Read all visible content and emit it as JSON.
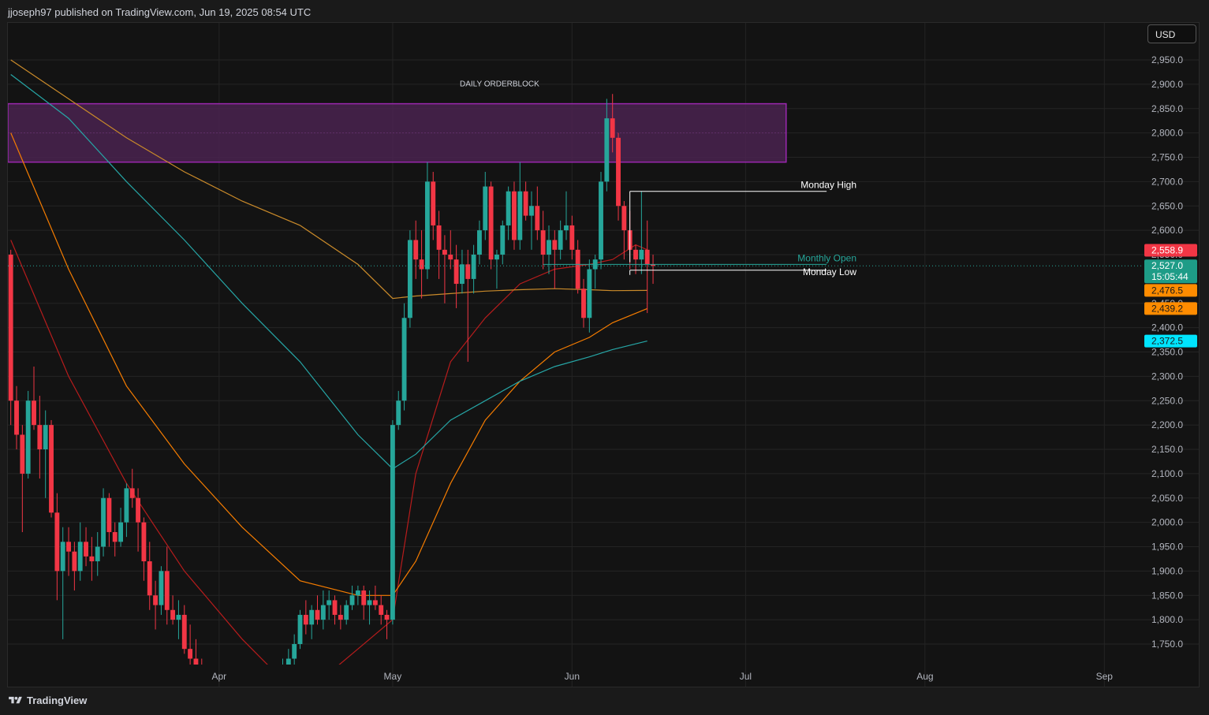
{
  "header": {
    "published_text": "jjoseph97 published on TradingView.com, Jun 19, 2025 08:54 UTC"
  },
  "currency_button": {
    "label": "USD"
  },
  "footer": {
    "brand": "TradingView",
    "logo_icon": "tradingview-logo-icon"
  },
  "colors": {
    "up": "#26a69a",
    "down": "#f23645",
    "ob_fill": "#4a2350",
    "ob_border": "#9c27b0",
    "ema_red": "#b71c1c",
    "ema_orange": "#f57c00",
    "ema_gold": "#c98a2a",
    "ema_teal": "#26a6a6"
  },
  "chart_data": {
    "type": "candlestick",
    "title": "",
    "xlabel": "",
    "ylabel": "",
    "ylim": [
      1710,
      2990
    ],
    "y_ticks": [
      "2,950.0",
      "2,900.0",
      "2,850.0",
      "2,800.0",
      "2,750.0",
      "2,700.0",
      "2,650.0",
      "2,600.0",
      "2,550.0",
      "2,450.0",
      "2,400.0",
      "2,350.0",
      "2,300.0",
      "2,250.0",
      "2,200.0",
      "2,150.0",
      "2,100.0",
      "2,050.0",
      "2,000.0",
      "1,950.0",
      "1,900.0",
      "1,850.0",
      "1,800.0",
      "1,750.0"
    ],
    "x_ticks": [
      {
        "label": "Apr",
        "bar": 36
      },
      {
        "label": "May",
        "bar": 66
      },
      {
        "label": "Jun",
        "bar": 97
      },
      {
        "label": "Jul",
        "bar": 127
      },
      {
        "label": "Aug",
        "bar": 158
      },
      {
        "label": "Sep",
        "bar": 189
      }
    ],
    "bar_count_visible": 196,
    "candles": [
      [
        2550,
        2560,
        2200,
        2250
      ],
      [
        2250,
        2280,
        2150,
        2180
      ],
      [
        2180,
        2200,
        1980,
        2100
      ],
      [
        2100,
        2270,
        2090,
        2250
      ],
      [
        2250,
        2320,
        2190,
        2200
      ],
      [
        2200,
        2260,
        2090,
        2150
      ],
      [
        2150,
        2230,
        2050,
        2200
      ],
      [
        2200,
        2210,
        2010,
        2020
      ],
      [
        2020,
        2060,
        1840,
        1900
      ],
      [
        1900,
        1990,
        1760,
        1960
      ],
      [
        1960,
        1990,
        1890,
        1940
      ],
      [
        1940,
        1960,
        1860,
        1900
      ],
      [
        1900,
        2000,
        1880,
        1960
      ],
      [
        1960,
        1990,
        1910,
        1930
      ],
      [
        1930,
        1970,
        1880,
        1920
      ],
      [
        1920,
        1980,
        1890,
        1950
      ],
      [
        1950,
        2070,
        1930,
        2050
      ],
      [
        2050,
        2060,
        1950,
        1980
      ],
      [
        1980,
        2000,
        1930,
        1960
      ],
      [
        1960,
        2030,
        1950,
        2000
      ],
      [
        2000,
        2080,
        1970,
        2070
      ],
      [
        2070,
        2110,
        2030,
        2050
      ],
      [
        2050,
        2070,
        1940,
        2000
      ],
      [
        2000,
        2010,
        1880,
        1920
      ],
      [
        1920,
        1960,
        1820,
        1850
      ],
      [
        1850,
        1880,
        1780,
        1830
      ],
      [
        1830,
        1910,
        1810,
        1900
      ],
      [
        1900,
        1950,
        1790,
        1820
      ],
      [
        1820,
        1850,
        1790,
        1800
      ],
      [
        1800,
        1840,
        1760,
        1810
      ],
      [
        1810,
        1830,
        1730,
        1740
      ],
      [
        1740,
        1790,
        1700,
        1720
      ],
      [
        1720,
        1760,
        1690,
        1700
      ],
      [
        1700,
        1720,
        1650,
        1670
      ],
      [
        1670,
        1700,
        1620,
        1650
      ],
      [
        1650,
        1680,
        1590,
        1610
      ],
      [
        1610,
        1640,
        1560,
        1600
      ],
      [
        1600,
        1660,
        1580,
        1640
      ],
      [
        1640,
        1660,
        1570,
        1590
      ],
      [
        1590,
        1620,
        1540,
        1580
      ],
      [
        1580,
        1640,
        1570,
        1620
      ],
      [
        1620,
        1650,
        1580,
        1600
      ],
      [
        1600,
        1630,
        1550,
        1570
      ],
      [
        1570,
        1620,
        1560,
        1610
      ],
      [
        1610,
        1650,
        1590,
        1630
      ],
      [
        1630,
        1660,
        1600,
        1640
      ],
      [
        1640,
        1680,
        1620,
        1670
      ],
      [
        1670,
        1720,
        1650,
        1700
      ],
      [
        1700,
        1740,
        1680,
        1720
      ],
      [
        1720,
        1770,
        1700,
        1750
      ],
      [
        1750,
        1820,
        1740,
        1810
      ],
      [
        1810,
        1840,
        1770,
        1790
      ],
      [
        1790,
        1830,
        1760,
        1820
      ],
      [
        1820,
        1850,
        1790,
        1800
      ],
      [
        1800,
        1860,
        1780,
        1830
      ],
      [
        1830,
        1860,
        1800,
        1840
      ],
      [
        1840,
        1850,
        1790,
        1810
      ],
      [
        1810,
        1830,
        1780,
        1800
      ],
      [
        1800,
        1840,
        1790,
        1830
      ],
      [
        1830,
        1870,
        1820,
        1850
      ],
      [
        1850,
        1870,
        1830,
        1860
      ],
      [
        1860,
        1870,
        1800,
        1830
      ],
      [
        1830,
        1860,
        1790,
        1840
      ],
      [
        1840,
        1870,
        1820,
        1830
      ],
      [
        1830,
        1850,
        1790,
        1810
      ],
      [
        1810,
        1820,
        1760,
        1800
      ],
      [
        1800,
        2210,
        1790,
        2200
      ],
      [
        2200,
        2270,
        2190,
        2250
      ],
      [
        2250,
        2450,
        2230,
        2420
      ],
      [
        2420,
        2600,
        2400,
        2580
      ],
      [
        2580,
        2620,
        2500,
        2540
      ],
      [
        2540,
        2600,
        2460,
        2520
      ],
      [
        2520,
        2740,
        2500,
        2700
      ],
      [
        2700,
        2720,
        2580,
        2610
      ],
      [
        2610,
        2640,
        2500,
        2560
      ],
      [
        2560,
        2590,
        2450,
        2550
      ],
      [
        2550,
        2600,
        2520,
        2540
      ],
      [
        2540,
        2570,
        2440,
        2490
      ],
      [
        2490,
        2560,
        2470,
        2530
      ],
      [
        2530,
        2560,
        2330,
        2500
      ],
      [
        2500,
        2570,
        2470,
        2550
      ],
      [
        2550,
        2620,
        2530,
        2600
      ],
      [
        2600,
        2720,
        2580,
        2690
      ],
      [
        2690,
        2700,
        2520,
        2540
      ],
      [
        2540,
        2560,
        2480,
        2550
      ],
      [
        2550,
        2620,
        2530,
        2610
      ],
      [
        2610,
        2690,
        2580,
        2680
      ],
      [
        2680,
        2700,
        2560,
        2580
      ],
      [
        2580,
        2740,
        2560,
        2680
      ],
      [
        2680,
        2700,
        2620,
        2630
      ],
      [
        2630,
        2680,
        2560,
        2650
      ],
      [
        2650,
        2690,
        2580,
        2600
      ],
      [
        2600,
        2640,
        2520,
        2550
      ],
      [
        2550,
        2610,
        2510,
        2580
      ],
      [
        2580,
        2600,
        2480,
        2560
      ],
      [
        2560,
        2620,
        2540,
        2600
      ],
      [
        2600,
        2680,
        2580,
        2610
      ],
      [
        2610,
        2630,
        2540,
        2560
      ],
      [
        2560,
        2580,
        2470,
        2480
      ],
      [
        2480,
        2500,
        2400,
        2420
      ],
      [
        2420,
        2540,
        2390,
        2520
      ],
      [
        2520,
        2550,
        2480,
        2540
      ],
      [
        2540,
        2720,
        2520,
        2700
      ],
      [
        2700,
        2870,
        2680,
        2830
      ],
      [
        2830,
        2880,
        2760,
        2790
      ],
      [
        2790,
        2800,
        2620,
        2650
      ],
      [
        2650,
        2660,
        2540,
        2600
      ],
      [
        2600,
        2640,
        2520,
        2560
      ],
      [
        2560,
        2570,
        2510,
        2540
      ],
      [
        2540,
        2680,
        2510,
        2560
      ],
      [
        2560,
        2620,
        2430,
        2530
      ],
      [
        2530,
        2550,
        2490,
        2527
      ]
    ],
    "candle_start_bar": 0,
    "series": [
      {
        "name": "",
        "color_key": "ema_red",
        "points": [
          [
            0,
            2580
          ],
          [
            10,
            2300
          ],
          [
            20,
            2080
          ],
          [
            30,
            1900
          ],
          [
            40,
            1760
          ],
          [
            50,
            1640
          ],
          [
            60,
            1740
          ],
          [
            66,
            1800
          ],
          [
            70,
            2100
          ],
          [
            76,
            2330
          ],
          [
            82,
            2420
          ],
          [
            88,
            2490
          ],
          [
            94,
            2520
          ],
          [
            100,
            2530
          ],
          [
            104,
            2540
          ],
          [
            108,
            2570
          ],
          [
            110,
            2560
          ]
        ]
      },
      {
        "name": "",
        "color_key": "ema_orange",
        "points": [
          [
            0,
            2800
          ],
          [
            10,
            2520
          ],
          [
            20,
            2280
          ],
          [
            30,
            2120
          ],
          [
            40,
            1990
          ],
          [
            50,
            1880
          ],
          [
            60,
            1850
          ],
          [
            66,
            1850
          ],
          [
            70,
            1920
          ],
          [
            76,
            2080
          ],
          [
            82,
            2210
          ],
          [
            88,
            2290
          ],
          [
            94,
            2350
          ],
          [
            100,
            2380
          ],
          [
            104,
            2410
          ],
          [
            110,
            2439.2
          ]
        ]
      },
      {
        "name": "",
        "color_key": "ema_gold",
        "points": [
          [
            0,
            2950
          ],
          [
            10,
            2870
          ],
          [
            20,
            2790
          ],
          [
            30,
            2720
          ],
          [
            40,
            2660
          ],
          [
            50,
            2610
          ],
          [
            60,
            2530
          ],
          [
            66,
            2460
          ],
          [
            70,
            2465
          ],
          [
            76,
            2470
          ],
          [
            82,
            2475
          ],
          [
            88,
            2478
          ],
          [
            94,
            2480
          ],
          [
            100,
            2478
          ],
          [
            104,
            2476
          ],
          [
            110,
            2476.5
          ]
        ]
      },
      {
        "name": "",
        "color_key": "ema_teal",
        "points": [
          [
            0,
            2920
          ],
          [
            10,
            2830
          ],
          [
            20,
            2700
          ],
          [
            30,
            2580
          ],
          [
            40,
            2450
          ],
          [
            50,
            2330
          ],
          [
            60,
            2180
          ],
          [
            66,
            2110
          ],
          [
            70,
            2140
          ],
          [
            76,
            2210
          ],
          [
            82,
            2250
          ],
          [
            88,
            2290
          ],
          [
            94,
            2320
          ],
          [
            100,
            2340
          ],
          [
            104,
            2355
          ],
          [
            110,
            2372.5
          ]
        ]
      }
    ],
    "orderblock": {
      "label": "DAILY ORDERBLOCK",
      "y_top": 2860,
      "y_bottom": 2740,
      "bar_start": 0,
      "bar_end": 134
    },
    "levels": [
      {
        "label": "Monday High",
        "value": 2680,
        "bar_start": 107,
        "bar_end": 141,
        "color": "#ffffff"
      },
      {
        "label": "Monthly Open",
        "value": 2530,
        "bar_start": 92,
        "bar_end": 141,
        "color": "#26a69a"
      },
      {
        "label": "Monday Low",
        "value": 2518,
        "bar_start": 107,
        "bar_end": 141,
        "color": "#ffffff"
      }
    ],
    "price_tags": [
      {
        "value": 2558.9,
        "label": "2,558.9",
        "bg": "#f23645",
        "fg": "#ffffff"
      },
      {
        "value": 2527.0,
        "label": "2,527.0",
        "sub": "15:05:44",
        "bg": "#1e9c87",
        "fg": "#ffffff"
      },
      {
        "value": 2476.5,
        "label": "2,476.5",
        "bg": "#ff8c00",
        "fg": "#1a1a1a"
      },
      {
        "value": 2439.2,
        "label": "2,439.2",
        "bg": "#ff8c00",
        "fg": "#1a1a1a"
      },
      {
        "value": 2372.5,
        "label": "2,372.5",
        "bg": "#00e5ff",
        "fg": "#1a1a1a"
      }
    ],
    "grid": true
  }
}
